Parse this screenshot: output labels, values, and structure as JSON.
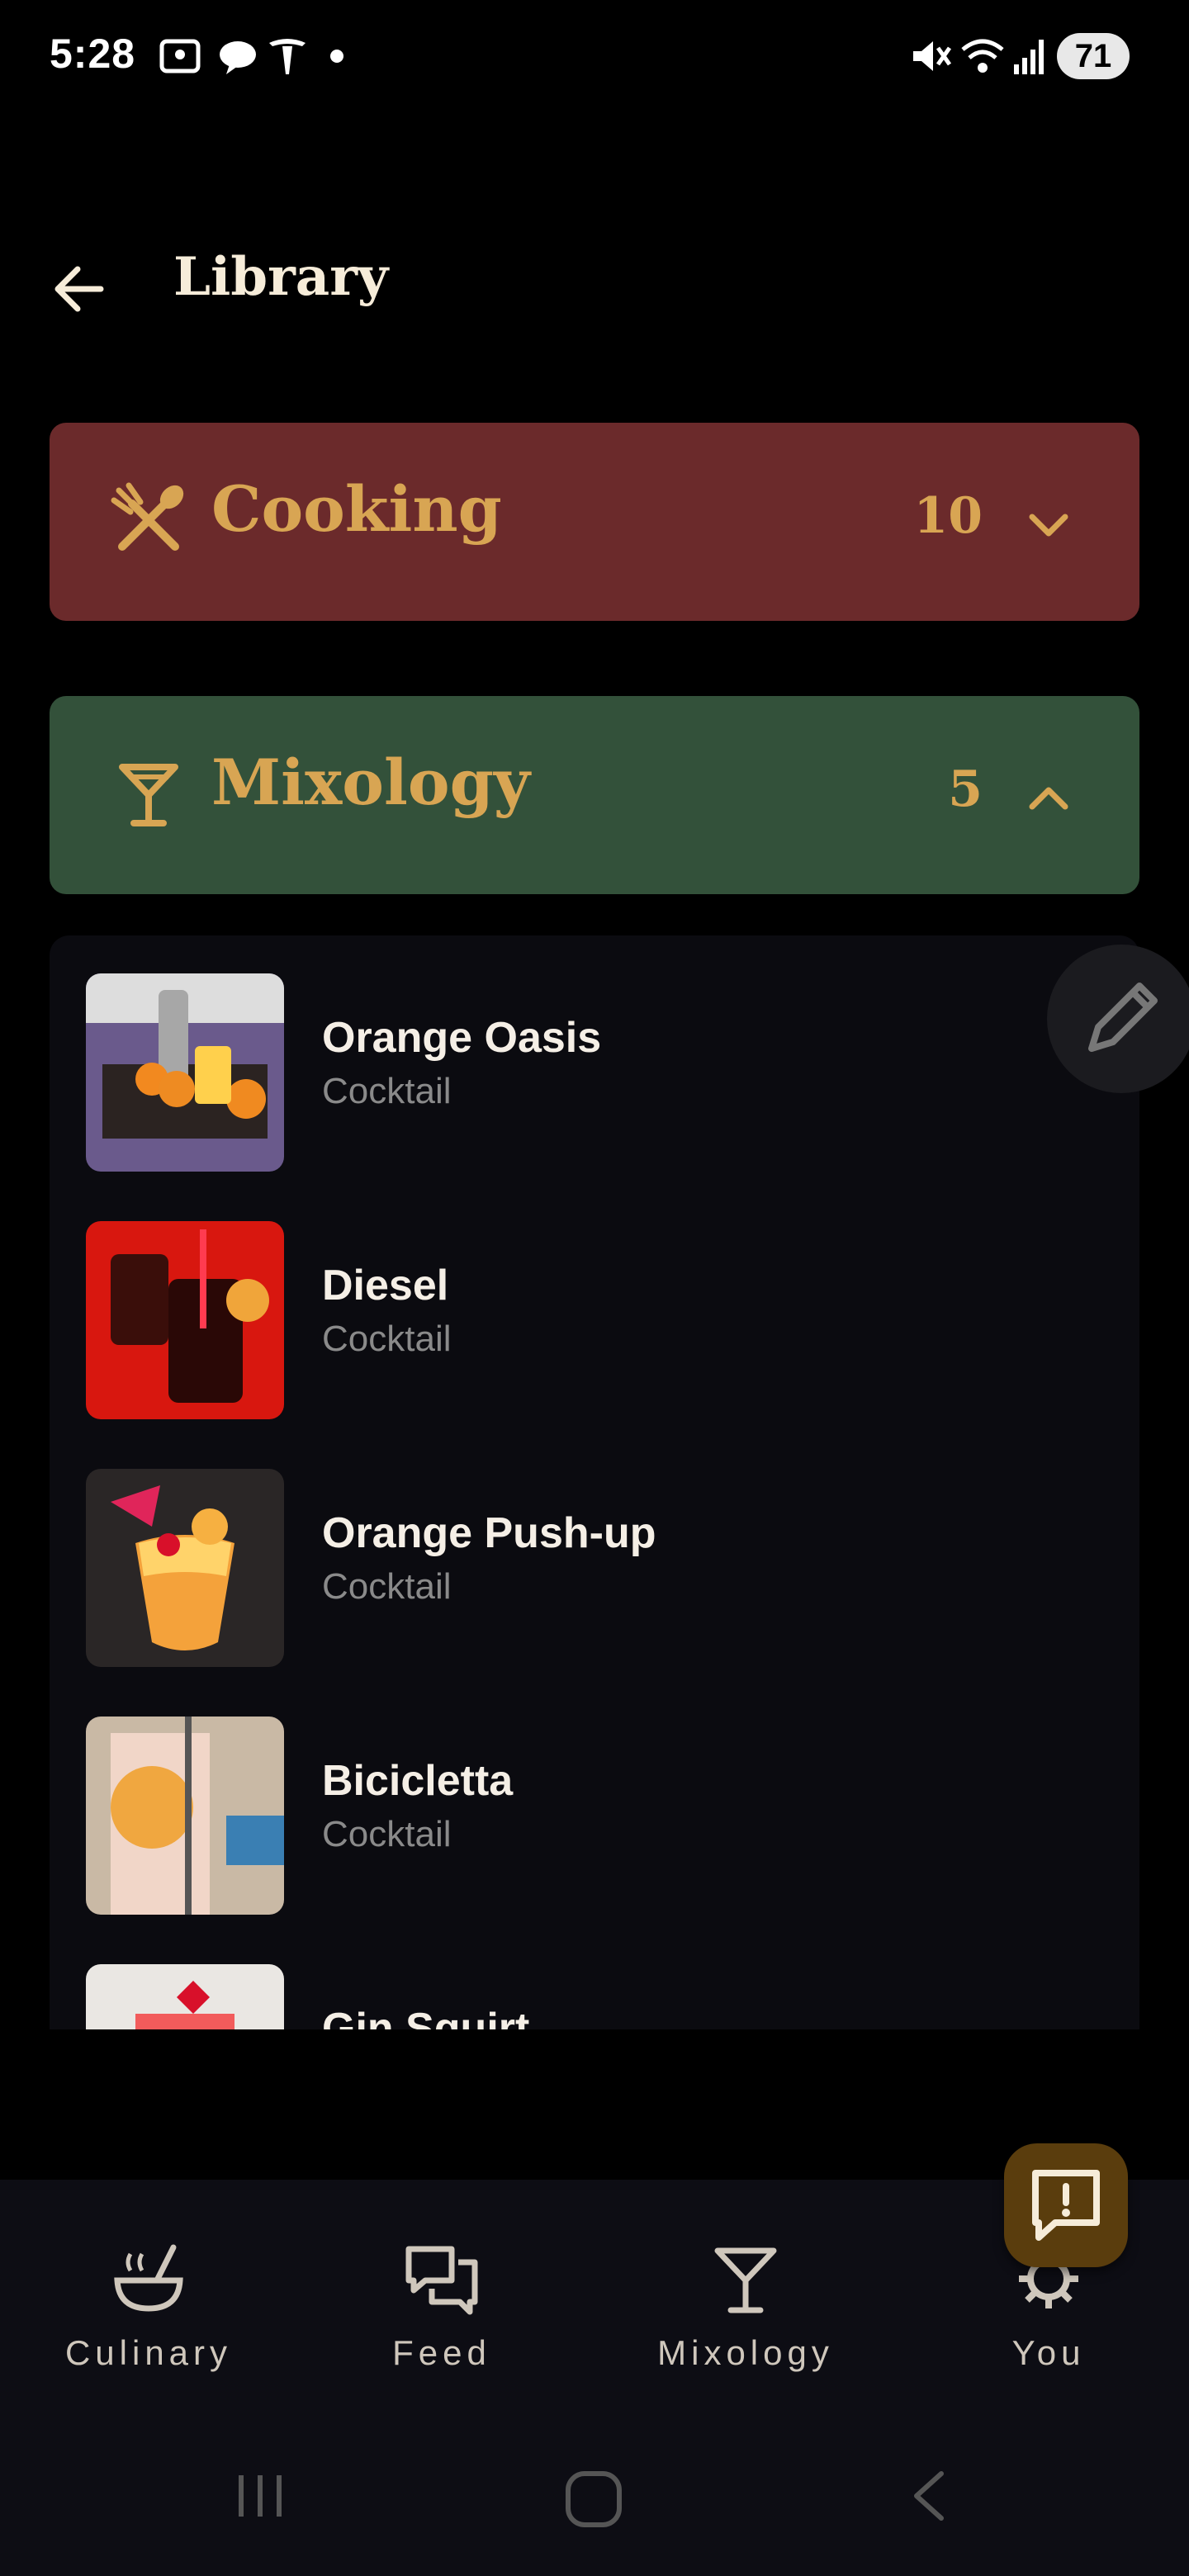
{
  "status_bar": {
    "time": "5:28",
    "battery": "71"
  },
  "header": {
    "title": "Library"
  },
  "categories": [
    {
      "label": "Cooking",
      "count": "10",
      "icon": "fork-spoon-icon",
      "expanded": false,
      "color": "#6b2a2b"
    },
    {
      "label": "Mixology",
      "count": "5",
      "icon": "cocktail-glass-icon",
      "expanded": true,
      "color": "#33513a"
    }
  ],
  "recipes": [
    {
      "name": "Orange Oasis",
      "type": "Cocktail"
    },
    {
      "name": "Diesel",
      "type": "Cocktail"
    },
    {
      "name": "Orange Push-up",
      "type": "Cocktail"
    },
    {
      "name": "Bicicletta",
      "type": "Cocktail"
    },
    {
      "name": "Gin Squirt",
      "type": ""
    }
  ],
  "bottom_nav": [
    {
      "label": "Culinary",
      "icon": "soup-bowl-icon"
    },
    {
      "label": "Feed",
      "icon": "chat-bubbles-icon"
    },
    {
      "label": "Mixology",
      "icon": "cocktail-glass-icon"
    },
    {
      "label": "You",
      "icon": "gear-icon"
    }
  ],
  "colors": {
    "accent": "#d8a553",
    "background": "#000000"
  }
}
